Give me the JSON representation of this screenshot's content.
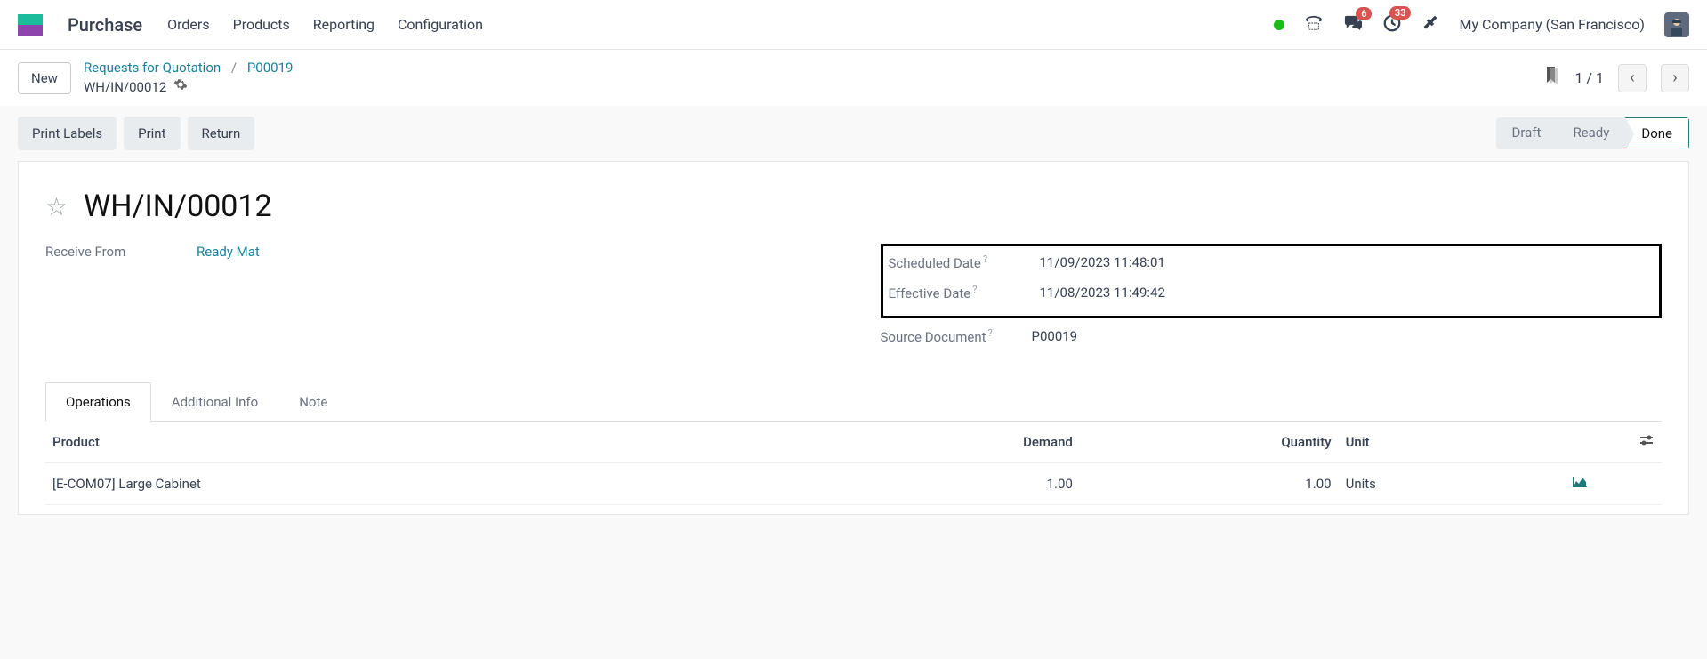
{
  "header": {
    "app_name": "Purchase",
    "menu": [
      "Orders",
      "Products",
      "Reporting",
      "Configuration"
    ],
    "messages_badge": "6",
    "activities_badge": "33",
    "company": "My Company (San Francisco)"
  },
  "subheader": {
    "new_label": "New",
    "breadcrumb_root": "Requests for Quotation",
    "breadcrumb_parent": "P00019",
    "breadcrumb_current": "WH/IN/00012",
    "pager": "1 / 1"
  },
  "toolbar": {
    "print_labels": "Print Labels",
    "print": "Print",
    "return": "Return",
    "statuses": [
      "Draft",
      "Ready",
      "Done"
    ],
    "active_status": "Done"
  },
  "record": {
    "title": "WH/IN/00012",
    "receive_from_label": "Receive From",
    "receive_from_value": "Ready Mat",
    "scheduled_date_label": "Scheduled Date",
    "scheduled_date_value": "11/09/2023 11:48:01",
    "effective_date_label": "Effective Date",
    "effective_date_value": "11/08/2023 11:49:42",
    "source_doc_label": "Source Document",
    "source_doc_value": "P00019"
  },
  "tabs": [
    "Operations",
    "Additional Info",
    "Note"
  ],
  "table": {
    "headers": {
      "product": "Product",
      "demand": "Demand",
      "quantity": "Quantity",
      "unit": "Unit"
    },
    "rows": [
      {
        "product": "[E-COM07] Large Cabinet",
        "demand": "1.00",
        "quantity": "1.00",
        "unit": "Units"
      }
    ]
  }
}
